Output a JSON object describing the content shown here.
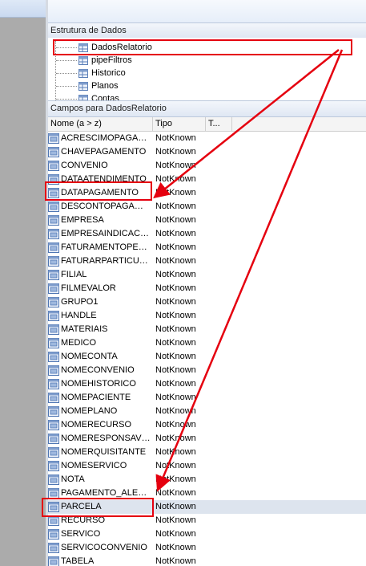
{
  "tree_panel": {
    "title": "Estrutura de Dados",
    "items": [
      "DadosRelatorio",
      "pipeFiltros",
      "Historico",
      "Planos",
      "Contas"
    ]
  },
  "fields_panel": {
    "title": "Campos para DadosRelatorio",
    "columns": [
      "Nome (a > z)",
      "Tipo",
      "T..."
    ],
    "rows": [
      {
        "name": "ACRESCIMOPAGAM...",
        "type": "NotKnown"
      },
      {
        "name": "CHAVEPAGAMENTO",
        "type": "NotKnown"
      },
      {
        "name": "CONVENIO",
        "type": "NotKnown"
      },
      {
        "name": "DATAATENDIMENTO",
        "type": "NotKnown"
      },
      {
        "name": "DATAPAGAMENTO",
        "type": "NotKnown"
      },
      {
        "name": "DESCONTOPAGAME...",
        "type": "NotKnown"
      },
      {
        "name": "EMPRESA",
        "type": "NotKnown"
      },
      {
        "name": "EMPRESAINDICACAO",
        "type": "NotKnown"
      },
      {
        "name": "FATURAMENTOPERC",
        "type": "NotKnown"
      },
      {
        "name": "FATURARPARTICUL...",
        "type": "NotKnown"
      },
      {
        "name": "FILIAL",
        "type": "NotKnown"
      },
      {
        "name": "FILMEVALOR",
        "type": "NotKnown"
      },
      {
        "name": "GRUPO1",
        "type": "NotKnown"
      },
      {
        "name": "HANDLE",
        "type": "NotKnown"
      },
      {
        "name": "MATERIAIS",
        "type": "NotKnown"
      },
      {
        "name": "MEDICO",
        "type": "NotKnown"
      },
      {
        "name": "NOMECONTA",
        "type": "NotKnown"
      },
      {
        "name": "NOMECONVENIO",
        "type": "NotKnown"
      },
      {
        "name": "NOMEHISTORICO",
        "type": "NotKnown"
      },
      {
        "name": "NOMEPACIENTE",
        "type": "NotKnown"
      },
      {
        "name": "NOMEPLANO",
        "type": "NotKnown"
      },
      {
        "name": "NOMERECURSO",
        "type": "NotKnown"
      },
      {
        "name": "NOMERESPONSAVEL",
        "type": "NotKnown"
      },
      {
        "name": "NOMERQUISITANTE",
        "type": "NotKnown"
      },
      {
        "name": "NOMESERVICO",
        "type": "NotKnown"
      },
      {
        "name": "NOTA",
        "type": "NotKnown"
      },
      {
        "name": "PAGAMENTO_ALEA...",
        "type": "NotKnown"
      },
      {
        "name": "PARCELA",
        "type": "NotKnown"
      },
      {
        "name": "RECURSO",
        "type": "NotKnown"
      },
      {
        "name": "SERVICO",
        "type": "NotKnown"
      },
      {
        "name": "SERVICOCONVENIO",
        "type": "NotKnown"
      },
      {
        "name": "TABELA",
        "type": "NotKnown"
      }
    ]
  },
  "colors": {
    "highlight_red": "#e5000f",
    "header_blue": "#dfe7f3",
    "selected_row": "#dde4ee"
  },
  "icons": {
    "tree_item": "table-icon",
    "field": "field-icon"
  }
}
